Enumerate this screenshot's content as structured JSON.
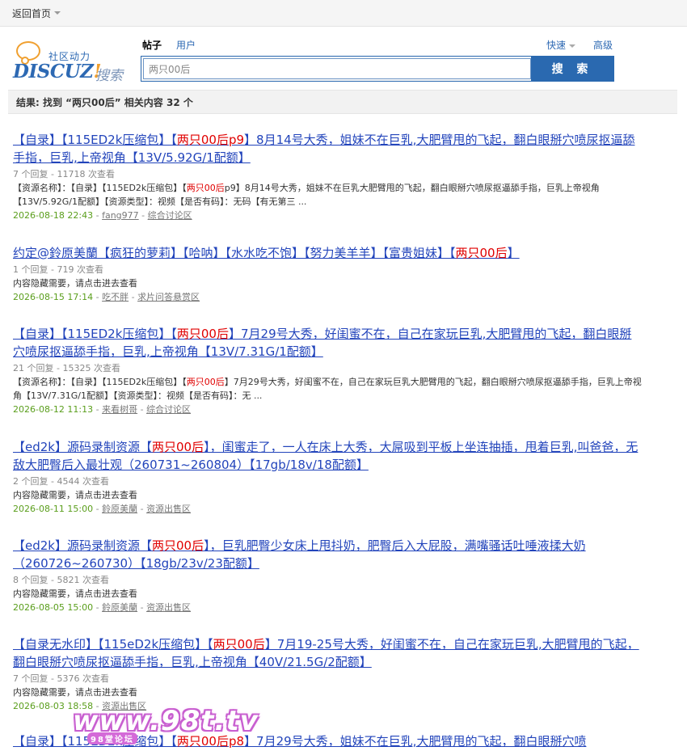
{
  "topbar": {
    "back_label": "返回首页"
  },
  "logo": {
    "tagline": "社区动力",
    "brand_main": "DISCUZ",
    "brand_bang": "!",
    "brand_sub": "搜索"
  },
  "search": {
    "type_post": "帖子",
    "type_user": "用户",
    "quick": "快速",
    "advanced": "高级",
    "value": "两只00后",
    "button": "搜 索"
  },
  "result_summary": "结果: 找到 “两只00后” 相关内容 32 个",
  "results": [
    {
      "title_pre": "【自录】【115ED2k压缩包】【",
      "title_hl": "两只00后p9",
      "title_post": "】8月14号大秀，姐妹不在巨乳,大肥臂甩的飞起，翻白眼掰穴喷尿抠逼舔手指，巨乳,上帝视角【13V/5.92G/1配额】",
      "meta": "7 个回复 - 11718 次查看",
      "summary_pre": "【资源名称】：【自录】【115ED2k压缩包】【",
      "summary_hl": "两只00后",
      "summary_post": "p9】8月14号大秀，姐妹不在巨乳大肥臂甩的飞起，翻白眼掰穴喷尿抠逼舔手指，巨乳上帝视角【13V/5.92G/1配额】【资源类型】：视频【是否有码】：无码【有无第三 ...",
      "date": "2026-08-18 22:43",
      "author": "fang977",
      "forum": "综合讨论区"
    },
    {
      "title_pre": "约定@鈴原美蘭【疯狂的萝莉】【哈呐】【水水吃不饱】【努力美羊羊】【富贵姐妹】【",
      "title_hl": "两只00后",
      "title_post": "】",
      "meta": "1 个回复 - 719 次查看",
      "summary_pre": "内容隐藏需要，请点击进去查看",
      "summary_hl": "",
      "summary_post": "",
      "date": "2026-08-15 17:14",
      "author": "吃不胖",
      "forum": "求片问答悬赏区"
    },
    {
      "title_pre": "【自录】【115ED2k压缩包】【",
      "title_hl": "两只00后",
      "title_post": "】7月29号大秀，好闺蜜不在，自己在家玩巨乳,大肥臂甩的飞起，翻白眼掰穴喷尿抠逼舔手指，巨乳,上帝视角【13V/7.31G/1配额】",
      "meta": "21 个回复 - 15325 次查看",
      "summary_pre": "【资源名称】：【自录】【115ED2k压缩包】【",
      "summary_hl": "两只00后",
      "summary_post": "】7月29号大秀，好闺蜜不在，自己在家玩巨乳大肥臂甩的飞起，翻白眼掰穴喷尿抠逼舔手指，巨乳上帝视角【13V/7.31G/1配额】【资源类型】：视频【是否有码】：无 ...",
      "date": "2026-08-12 11:13",
      "author": "来看树哥",
      "forum": "综合讨论区"
    },
    {
      "title_pre": "【ed2k】源码录制资源【",
      "title_hl": "两只00后",
      "title_post": "】，闺蜜走了，一人在床上大秀，大屌吸到平板上坐连抽插，甩着巨乳,叫爸爸，无敌大肥臀后入最壮观（260731~260804）【17gb/18v/18配额】",
      "meta": "2 个回复 - 4544 次查看",
      "summary_pre": "内容隐藏需要，请点击进去查看",
      "summary_hl": "",
      "summary_post": "",
      "date": "2026-08-11 15:00",
      "author": "鈴原美蘭",
      "forum": "资源出售区"
    },
    {
      "title_pre": "【ed2k】源码录制资源【",
      "title_hl": "两只00后",
      "title_post": "】，巨乳肥臀少女床上甩抖奶，肥臀后入大屁股，满嘴骚话吐唾液揉大奶（260726~260730）【18gb/23v/23配额】",
      "meta": "8 个回复 - 5821 次查看",
      "summary_pre": "内容隐藏需要，请点击进去查看",
      "summary_hl": "",
      "summary_post": "",
      "date": "2026-08-05 15:00",
      "author": "鈴原美蘭",
      "forum": "资源出售区"
    },
    {
      "title_pre": "【自录无水印】【115eD2k压缩包】【",
      "title_hl": "两只00后",
      "title_post": "】7月19-25号大秀，好闺蜜不在，自己在家玩巨乳,大肥臂甩的飞起，翻白眼掰穴喷尿抠逼舔手指，巨乳,上帝视角【40V/21.5G/2配额】",
      "meta": "7 个回复 - 5376 次查看",
      "summary_pre": "内容隐藏需要，请点击进去查看",
      "summary_hl": "",
      "summary_post": "",
      "date": "2026-08-03 18:58",
      "author": "",
      "forum": "资源出售区"
    },
    {
      "title_pre": "【自录】【115ED2k压缩包】【",
      "title_hl": "两只00后p8",
      "title_post": "】7月29号大秀，姐妹不在巨乳,大肥臂甩的飞起，翻白眼掰穴喷",
      "meta": "",
      "summary_pre": "",
      "summary_hl": "",
      "summary_post": "",
      "date": "",
      "author": "",
      "forum": ""
    }
  ],
  "watermark": {
    "text": "www.98t.tv",
    "sub": "98堂论坛"
  }
}
